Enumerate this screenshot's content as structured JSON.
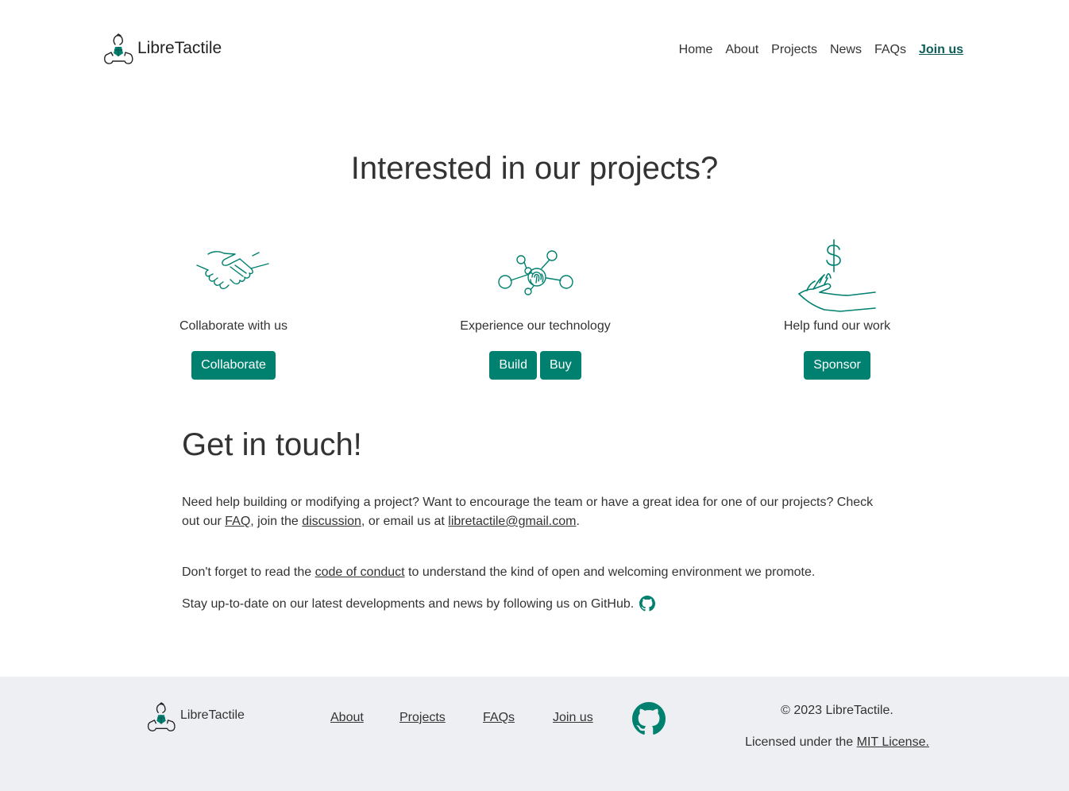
{
  "brand": {
    "name": "LibreTactile",
    "logo_icon": "hand-logo-icon"
  },
  "nav": {
    "items": [
      {
        "label": "Home"
      },
      {
        "label": "About"
      },
      {
        "label": "Projects"
      },
      {
        "label": "News"
      },
      {
        "label": "FAQs"
      },
      {
        "label": "Join us",
        "active": true
      }
    ]
  },
  "hero": {
    "title": "Interested in our projects?"
  },
  "cards": [
    {
      "icon": "handshake-icon",
      "label": "Collaborate with us",
      "buttons": [
        "Collaborate"
      ]
    },
    {
      "icon": "network-fingerprint-icon",
      "label": "Experience our technology",
      "buttons": [
        "Build",
        "Buy"
      ]
    },
    {
      "icon": "hand-dollar-icon",
      "label": "Help fund our work",
      "buttons": [
        "Sponsor"
      ]
    }
  ],
  "touch": {
    "title": "Get in touch!",
    "p1_text1": "Need help building or modifying a project? Want to encourage the team or have a great idea for one of our projects? Check out our ",
    "p1_link_faq": "FAQ",
    "p1_text2": ", join the ",
    "p1_link_discussion": "discussion",
    "p1_text3": ", or email us at ",
    "p1_link_email": "libretactile@gmail.com",
    "p1_text4": ".",
    "p2_text1": "Don't forget to read the ",
    "p2_link": "code of conduct",
    "p2_text2": " to understand the kind of open and welcoming environment we promote.",
    "p3_text": "Stay up-to-date on our latest developments and news by following us on GitHub.",
    "github_icon": "github-icon"
  },
  "footer": {
    "brand": "LibreTactile",
    "links": [
      {
        "label": "About"
      },
      {
        "label": "Projects"
      },
      {
        "label": "FAQs"
      },
      {
        "label": "Join us"
      }
    ],
    "github_icon": "github-icon",
    "copyright": "© 2023 LibreTactile.",
    "license_text": "Licensed under the ",
    "license_link": "MIT License."
  },
  "colors": {
    "accent": "#00806f",
    "active_nav": "#0b5e57",
    "footer_bg": "#eeeff2"
  }
}
